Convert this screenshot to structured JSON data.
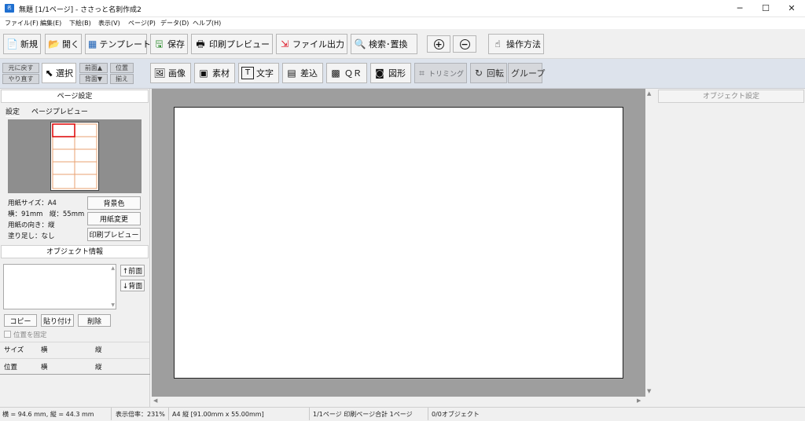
{
  "window": {
    "title": "無題 [1/1ページ] - ささっと名刺作成2",
    "minimize": "─",
    "maximize": "☐",
    "close": "✕"
  },
  "menu": [
    "ファイル(F)",
    "編集(E)",
    "下絵(B)",
    "表示(V)",
    "ページ(P)",
    "データ(D)",
    "ヘルプ(H)"
  ],
  "toolbar1": {
    "new": "新規",
    "open": "開く",
    "template": "テンプレート",
    "save": "保存",
    "print_preview": "印刷プレビュー",
    "file_output": "ファイル出力",
    "search_replace": "検索･置換",
    "zoom_in": "+",
    "zoom_out": "−",
    "howto": "操作方法"
  },
  "toolbar2": {
    "undo": "元に戻す",
    "redo": "やり直す",
    "select": "選択",
    "front": "前面▲",
    "back": "背面▼",
    "align1": "位置",
    "align2": "揃え",
    "image": "画像",
    "material": "素材",
    "text": "文字",
    "merge": "差込",
    "qr": "ＱＲ",
    "shape": "図形",
    "trimming": "トリミング",
    "rotate": "回転",
    "group": "グループ"
  },
  "left": {
    "page_settings": "ページ設定",
    "tab_settings": "設定",
    "tab_preview": "ページプレビュー",
    "paper_size": "用紙サイズ：A4",
    "dimensions": "横：91mm　縦：55mm",
    "orientation": "用紙の向き：縦",
    "bleed": "塗り足し：なし",
    "bg_color": "背景色",
    "change_paper": "用紙変更",
    "print_preview": "印刷プレビュー",
    "object_info": "オブジェクト情報",
    "to_front": "↑前面",
    "to_back": "↓背面",
    "copy": "コピー",
    "paste": "貼り付け",
    "delete": "削除",
    "lock_position": "位置を固定",
    "size": "サイズ",
    "position": "位置",
    "horiz": "横",
    "vert": "縦"
  },
  "right": {
    "object_settings": "オブジェクト設定"
  },
  "status": {
    "coords": "横 = 94.6 mm, 縦 = 44.3 mm",
    "zoom": "表示倍率：231%",
    "paper": "A4 縦 [91.00mm x 55.00mm]",
    "pages": "1/1ページ 印刷ページ合計 1ページ",
    "objects": "0/0オブジェクト"
  }
}
